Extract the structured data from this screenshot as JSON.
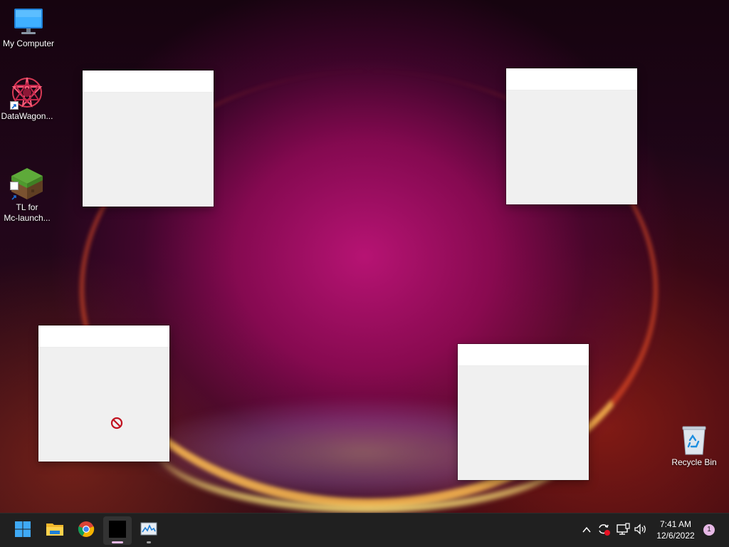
{
  "desktop": {
    "icons": [
      {
        "label": "My Computer",
        "icon": "monitor-icon",
        "shortcut": false
      },
      {
        "label": "DataWagon...",
        "icon": "datawagon-icon",
        "shortcut": true
      },
      {
        "label": "TL for\nMc-launch...",
        "icon": "minecraft-grass-block-icon",
        "shortcut": true
      },
      {
        "label": "Recycle Bin",
        "icon": "recycle-bin-icon",
        "shortcut": false
      }
    ],
    "blank_windows": 4,
    "cursor": "not-allowed-cursor-icon"
  },
  "taskbar": {
    "apps": [
      {
        "name": "Start",
        "icon": "windows-start-icon"
      },
      {
        "name": "File Explorer",
        "icon": "folder-icon"
      },
      {
        "name": "Google Chrome",
        "icon": "chrome-icon"
      },
      {
        "name": "Terminal",
        "icon": "terminal-icon",
        "active": true
      },
      {
        "name": "Task Manager",
        "icon": "task-manager-icon",
        "running": true
      }
    ],
    "tray": {
      "icons": [
        "chevron-up-icon",
        "sync-icon",
        "network-icon",
        "volume-icon"
      ],
      "time": "7:41 AM",
      "date": "12/6/2022",
      "notification_count": "1"
    }
  },
  "colors": {
    "taskbar_bg": "#202020",
    "accent_active": "#e7b9e6",
    "window_bg": "#f0f0f0"
  }
}
